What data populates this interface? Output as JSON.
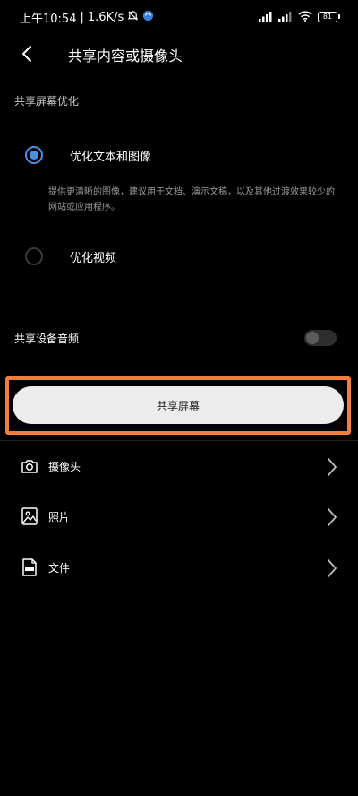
{
  "status_bar": {
    "time": "上午10:54",
    "separator": "|",
    "speed": "1.6K/s",
    "battery": "81",
    "icons": [
      "mute-icon",
      "app-badge-icon",
      "signal-icon",
      "signal-icon",
      "wifi-icon",
      "battery-icon"
    ]
  },
  "header": {
    "title": "共享内容或摄像头",
    "back_icon": "chevron-left-icon"
  },
  "optimization": {
    "section_title": "共享屏幕优化",
    "options": [
      {
        "label": "优化文本和图像",
        "checked": true
      },
      {
        "label": "优化视频",
        "checked": false
      }
    ],
    "description": "提供更清晰的图像，建议用于文档、演示文稿，以及其他过渡效果较少的网站或应用程序。"
  },
  "audio": {
    "label": "共享设备音频",
    "enabled": false
  },
  "share_button": {
    "label": "共享屏幕"
  },
  "list": [
    {
      "label": "摄像头",
      "icon": "camera-icon"
    },
    {
      "label": "照片",
      "icon": "image-icon"
    },
    {
      "label": "文件",
      "icon": "pdf-file-icon"
    }
  ],
  "colors": {
    "accent": "#4a90e2",
    "highlight": "#f47c3c",
    "background": "#000000",
    "button": "#ececec"
  }
}
